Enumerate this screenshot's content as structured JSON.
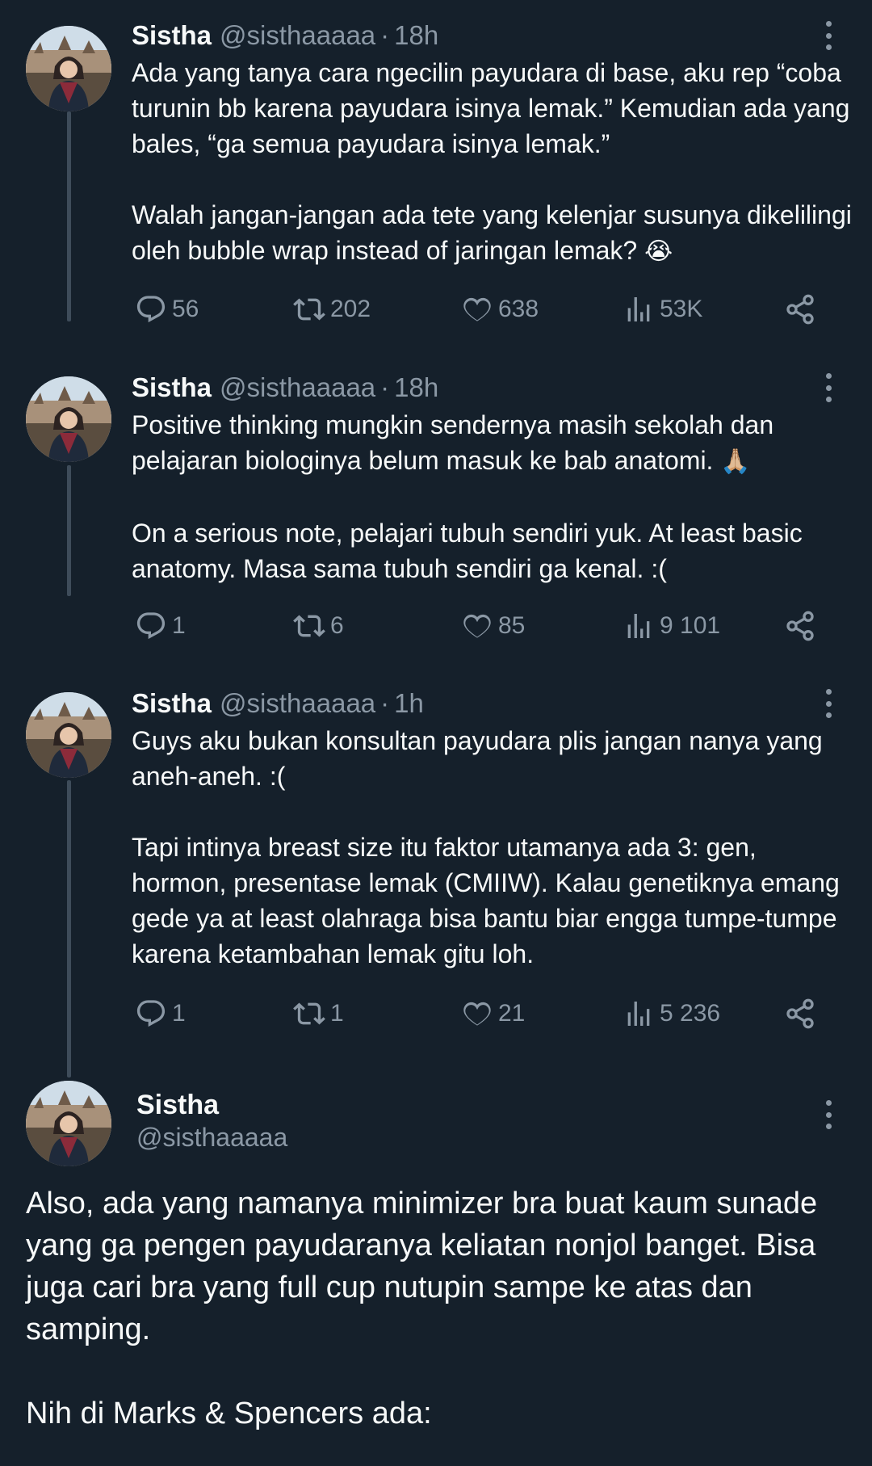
{
  "colors": {
    "background": "#15202b",
    "text_primary": "#f7f9f9",
    "text_secondary": "#8b98a5",
    "thread_line": "#3e4c5a"
  },
  "tweets": [
    {
      "name": "Sistha",
      "handle": "@sisthaaaaa",
      "dot": "·",
      "time": "18h",
      "paragraphs": [
        "Ada yang tanya cara ngecilin payudara di base, aku rep “coba turunin bb karena payudara isinya lemak.” Kemudian ada yang bales, “ga semua payudara isinya lemak.”",
        "Walah jangan-jangan ada tete yang kelenjar susunya dikelilingi oleh bubble wrap instead of jaringan lemak?"
      ],
      "emoji": "😭",
      "replies": "56",
      "retweets": "202",
      "likes": "638",
      "views": "53K"
    },
    {
      "name": "Sistha",
      "handle": "@sisthaaaaa",
      "dot": "·",
      "time": "18h",
      "paragraphs": [
        "Positive thinking mungkin sendernya masih sekolah dan pelajaran biologinya belum masuk ke bab anatomi.",
        "On a serious note, pelajari tubuh sendiri yuk. At least basic anatomy. Masa sama tubuh sendiri ga kenal. :("
      ],
      "emoji": "🙏🏼",
      "replies": "1",
      "retweets": "6",
      "likes": "85",
      "views": "9 101"
    },
    {
      "name": "Sistha",
      "handle": "@sisthaaaaa",
      "dot": "·",
      "time": "1h",
      "paragraphs": [
        "Guys aku bukan konsultan payudara plis jangan nanya yang aneh-aneh. :(",
        "Tapi intinya breast size itu faktor utamanya ada 3: gen, hormon, presentase lemak (CMIIW). Kalau genetiknya emang gede ya at least olahraga bisa bantu biar engga tumpe-tumpe karena ketambahan lemak gitu loh."
      ],
      "replies": "1",
      "retweets": "1",
      "likes": "21",
      "views": "5 236"
    }
  ],
  "main_tweet": {
    "name": "Sistha",
    "handle": "@sisthaaaaa",
    "paragraphs": [
      "Also, ada yang namanya minimizer bra buat kaum sunade yang ga pengen payudaranya keliatan nonjol banget. Bisa juga cari bra yang full cup nutupin sampe ke atas dan samping.",
      "Nih di Marks & Spencers ada:"
    ]
  },
  "icons": {
    "more": "more-vertical-icon",
    "reply": "reply-icon",
    "retweet": "retweet-icon",
    "like": "heart-icon",
    "views": "views-chart-icon",
    "share": "share-icon"
  }
}
